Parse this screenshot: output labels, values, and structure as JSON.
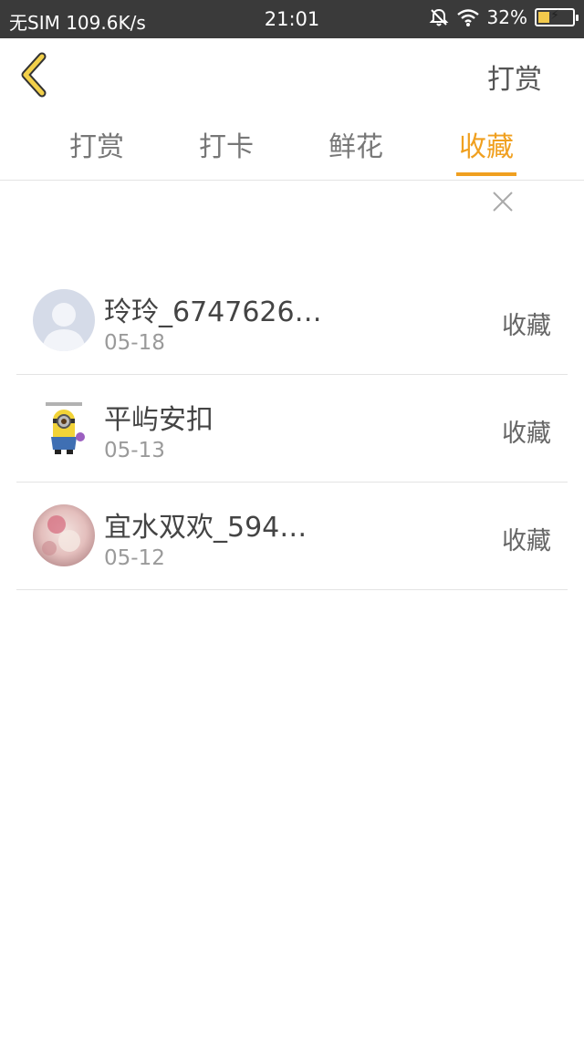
{
  "status_bar": {
    "carrier": "无SIM 109.6K/s",
    "time": "21:01",
    "battery": "32%",
    "battery_level": 0.32
  },
  "header": {
    "back_icon": "chevron-left-icon",
    "action_label": "打赏"
  },
  "tabs": [
    {
      "label": "打赏"
    },
    {
      "label": "打卡"
    },
    {
      "label": "鲜花"
    },
    {
      "label": "收藏"
    }
  ],
  "active_tab_index": 3,
  "accent_color": "#f0a020",
  "list": [
    {
      "name": "玲玲_6747626…",
      "date": "05-18",
      "tag": "收藏",
      "avatar": "default-person-avatar"
    },
    {
      "name": "平屿安扣",
      "date": "05-13",
      "tag": "收藏",
      "avatar": "minion-avatar"
    },
    {
      "name": "宜水双欢_594…",
      "date": "05-12",
      "tag": "收藏",
      "avatar": "photo-avatar"
    }
  ]
}
